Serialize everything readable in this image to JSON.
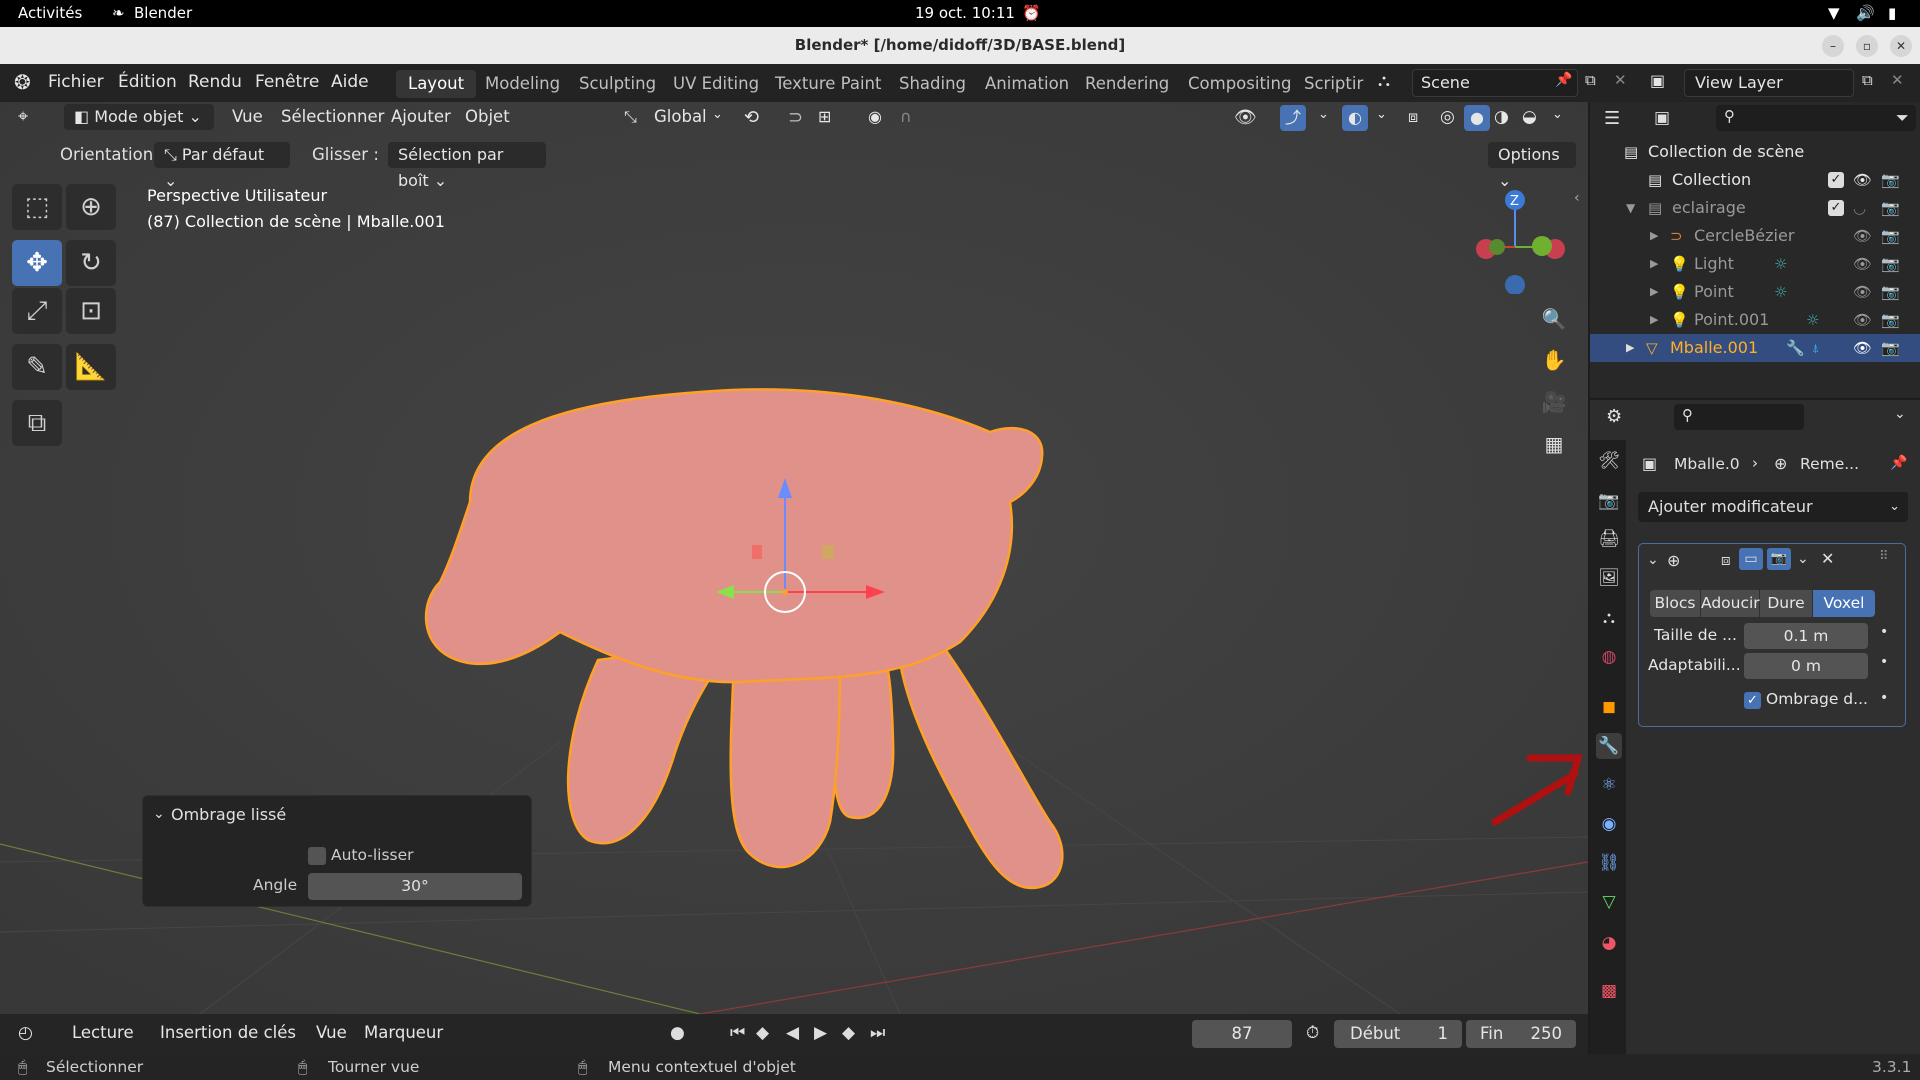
{
  "gnome": {
    "activities": "Activités",
    "app": "Blender",
    "clock": "19 oct.  10:11"
  },
  "window": {
    "title": "Blender* [/home/didoff/3D/BASE.blend]"
  },
  "menus": [
    "Fichier",
    "Édition",
    "Rendu",
    "Fenêtre",
    "Aide"
  ],
  "workspaces": [
    "Layout",
    "Modeling",
    "Sculpting",
    "UV Editing",
    "Texture Paint",
    "Shading",
    "Animation",
    "Rendering",
    "Compositing",
    "Scriptir"
  ],
  "scene": {
    "name": "Scene"
  },
  "view_layer": {
    "name": "View Layer"
  },
  "viewport_header": {
    "mode": "Mode objet",
    "menu": [
      "Vue",
      "Sélectionner",
      "Ajouter",
      "Objet"
    ],
    "transform": "Global"
  },
  "tool_settings": {
    "orientation_label": "Orientation:",
    "orientation_value": "Par défaut",
    "drag_label": "Glisser :",
    "drag_value": "Sélection par boît",
    "options": "Options"
  },
  "viewport": {
    "view_name": "Perspective Utilisateur",
    "context": "(87) Collection de scène | Mballe.001",
    "gizmo_z": "Z"
  },
  "last_operator": {
    "title": "Ombrage lissé",
    "auto_smooth": "Auto-lisser",
    "angle_label": "Angle",
    "angle_value": "30°"
  },
  "timeline": {
    "playback": "Lecture",
    "keying": "Insertion de clés",
    "view": "Vue",
    "marker": "Marqueur",
    "current_frame": "87",
    "start_label": "Début",
    "start": "1",
    "end_label": "Fin",
    "end": "250"
  },
  "status": {
    "select": "Sélectionner",
    "rotate": "Tourner vue",
    "context_menu": "Menu contextuel d'objet",
    "version": "3.3.1"
  },
  "outliner": {
    "rows": [
      {
        "name": "Collection de scène"
      },
      {
        "name": "Collection"
      },
      {
        "name": "eclairage"
      },
      {
        "name": "CercleBézier"
      },
      {
        "name": "Light"
      },
      {
        "name": "Point"
      },
      {
        "name": "Point.001"
      },
      {
        "name": "Mballe.001"
      }
    ]
  },
  "properties": {
    "object": "Mballe.0",
    "modifier_crumb": "Reme...",
    "add_modifier": "Ajouter modificateur",
    "modes": [
      "Blocs",
      "Adoucir",
      "Dure",
      "Voxel"
    ],
    "voxel_size_label": "Taille de ...",
    "voxel_size": "0.1 m",
    "adaptivity_label": "Adaptabili...",
    "adaptivity": "0 m",
    "smooth_shading": "Ombrage d..."
  },
  "colors": {
    "accent": "#4772b3",
    "selection": "#ffa028",
    "mesh": "#e0928a",
    "arrow": "#b01010"
  }
}
